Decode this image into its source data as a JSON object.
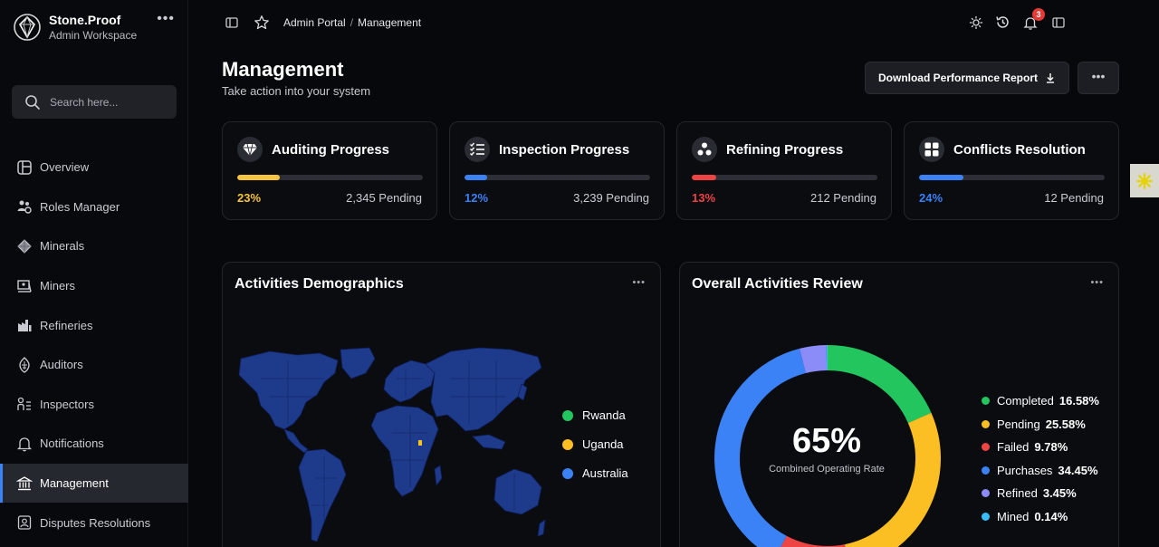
{
  "brand": {
    "title": "Stone.Proof",
    "subtitle": "Admin Workspace"
  },
  "search": {
    "placeholder": "Search here..."
  },
  "sidebar": {
    "items": [
      {
        "label": "Overview",
        "icon": "overview-icon"
      },
      {
        "label": "Roles Manager",
        "icon": "roles-icon"
      },
      {
        "label": "Minerals",
        "icon": "diamond-icon"
      },
      {
        "label": "Miners",
        "icon": "miner-icon"
      },
      {
        "label": "Refineries",
        "icon": "factory-icon"
      },
      {
        "label": "Auditors",
        "icon": "auditor-icon"
      },
      {
        "label": "Inspectors",
        "icon": "inspector-icon"
      },
      {
        "label": "Notifications",
        "icon": "bell-icon"
      },
      {
        "label": "Management",
        "icon": "bank-icon",
        "active": true
      },
      {
        "label": "Disputes Resolutions",
        "icon": "dispute-icon"
      }
    ]
  },
  "breadcrumb": {
    "root": "Admin Portal",
    "current": "Management"
  },
  "notifications": {
    "count": "3"
  },
  "header": {
    "title": "Management",
    "subtitle": "Take action into your system",
    "download_label": "Download Performance Report"
  },
  "cards": [
    {
      "title": "Auditing Progress",
      "percent_label": "23%",
      "progress": 0.23,
      "pending": "2,345 Pending",
      "color": "#f5c542",
      "icon": "diamond-icon"
    },
    {
      "title": "Inspection Progress",
      "percent_label": "12%",
      "progress": 0.12,
      "pending": "3,239 Pending",
      "color": "#3b82f6",
      "icon": "checklist-icon"
    },
    {
      "title": "Refining Progress",
      "percent_label": "13%",
      "progress": 0.13,
      "pending": "212 Pending",
      "color": "#ef4444",
      "icon": "molecule-icon"
    },
    {
      "title": "Conflicts Resolution",
      "percent_label": "24%",
      "progress": 0.24,
      "pending": "12 Pending",
      "color": "#3b82f6",
      "icon": "grid-icon"
    }
  ],
  "demographics": {
    "title": "Activities Demographics",
    "legend": [
      {
        "label": "Rwanda",
        "color": "#22c55e"
      },
      {
        "label": "Uganda",
        "color": "#fbbf24"
      },
      {
        "label": "Australia",
        "color": "#3b82f6"
      }
    ]
  },
  "review": {
    "title": "Overall Activities Review",
    "center_value": "65%",
    "center_label": "Combined Operating Rate",
    "segments": [
      {
        "label": "Completed",
        "value": "16.58%",
        "share": 16.58,
        "color": "#22c55e"
      },
      {
        "label": "Pending",
        "value": "25.58%",
        "share": 25.58,
        "color": "#fbbf24"
      },
      {
        "label": "Failed",
        "value": "9.78%",
        "share": 9.78,
        "color": "#ef4444"
      },
      {
        "label": "Purchases",
        "value": "34.45%",
        "share": 34.45,
        "color": "#3b82f6"
      },
      {
        "label": "Refined",
        "value": "3.45%",
        "share": 3.45,
        "color": "#8b8cf8"
      },
      {
        "label": "Mined",
        "value": "0.14%",
        "share": 0.14,
        "color": "#38bdf8"
      }
    ]
  }
}
